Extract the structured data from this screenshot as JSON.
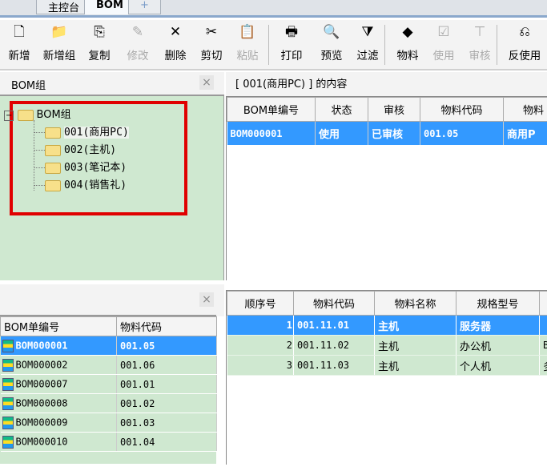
{
  "tabs": [
    {
      "label": "主控台"
    },
    {
      "label": "BOM ×"
    },
    {
      "label": "+"
    }
  ],
  "toolbar": [
    {
      "label": "新增",
      "icon": "new-doc-icon",
      "glyph": "🗋",
      "enabled": true
    },
    {
      "label": "新增组",
      "icon": "folder-icon",
      "glyph": "📁",
      "enabled": true
    },
    {
      "label": "复制",
      "icon": "copy-icon",
      "glyph": "⎘",
      "enabled": true
    },
    {
      "label": "修改",
      "icon": "edit-icon",
      "glyph": "✎",
      "enabled": false
    },
    {
      "label": "删除",
      "icon": "delete-icon",
      "glyph": "✕",
      "enabled": true
    },
    {
      "label": "剪切",
      "icon": "cut-icon",
      "glyph": "✂",
      "enabled": true
    },
    {
      "label": "粘贴",
      "icon": "paste-icon",
      "glyph": "📋",
      "enabled": false
    },
    {
      "label": "打印",
      "icon": "print-icon",
      "glyph": "🖶",
      "enabled": true
    },
    {
      "label": "预览",
      "icon": "preview-icon",
      "glyph": "🔍",
      "enabled": true
    },
    {
      "label": "过滤",
      "icon": "filter-icon",
      "glyph": "⧩",
      "enabled": true
    },
    {
      "label": "物料",
      "icon": "material-icon",
      "glyph": "◆",
      "enabled": true
    },
    {
      "label": "使用",
      "icon": "use-icon",
      "glyph": "☑",
      "enabled": false
    },
    {
      "label": "审核",
      "icon": "audit-icon",
      "glyph": "⊤",
      "enabled": false
    },
    {
      "label": "反使用",
      "icon": "unuse-icon",
      "glyph": "⎌",
      "enabled": true
    }
  ],
  "left_top": {
    "title": "BOM组",
    "close": "×",
    "tree_root": "BOM组",
    "tree_items": [
      "001(商用PC)",
      "002(主机)",
      "003(笔记本)",
      "004(销售礼)"
    ]
  },
  "right_top": {
    "title": "[ 001(商用PC) ] 的内容",
    "columns": [
      "BOM单编号",
      "状态",
      "审核",
      "物料代码",
      "物料"
    ],
    "rows": [
      [
        "BOM000001",
        "使用",
        "已审核",
        "001.05",
        "商用P"
      ]
    ]
  },
  "left_bottom": {
    "close": "×",
    "columns": [
      "BOM单编号",
      "物料代码"
    ],
    "rows": [
      [
        "BOM000001",
        "001.05"
      ],
      [
        "BOM000002",
        "001.06"
      ],
      [
        "BOM000007",
        "001.01"
      ],
      [
        "BOM000008",
        "001.02"
      ],
      [
        "BOM000009",
        "001.03"
      ],
      [
        "BOM000010",
        "001.04"
      ]
    ]
  },
  "right_bottom": {
    "columns": [
      "顺序号",
      "物料代码",
      "物料名称",
      "规格型号",
      ""
    ],
    "rows": [
      [
        "1",
        "001.11.01",
        "主机",
        "服务器",
        ""
      ],
      [
        "2",
        "001.11.02",
        "主机",
        "办公机",
        "B"
      ],
      [
        "3",
        "001.11.03",
        "主机",
        "个人机",
        "多"
      ]
    ]
  },
  "colors": {
    "selection": "#3399ff",
    "panel_green": "#cfe8d0",
    "highlight_box": "#e00000"
  }
}
